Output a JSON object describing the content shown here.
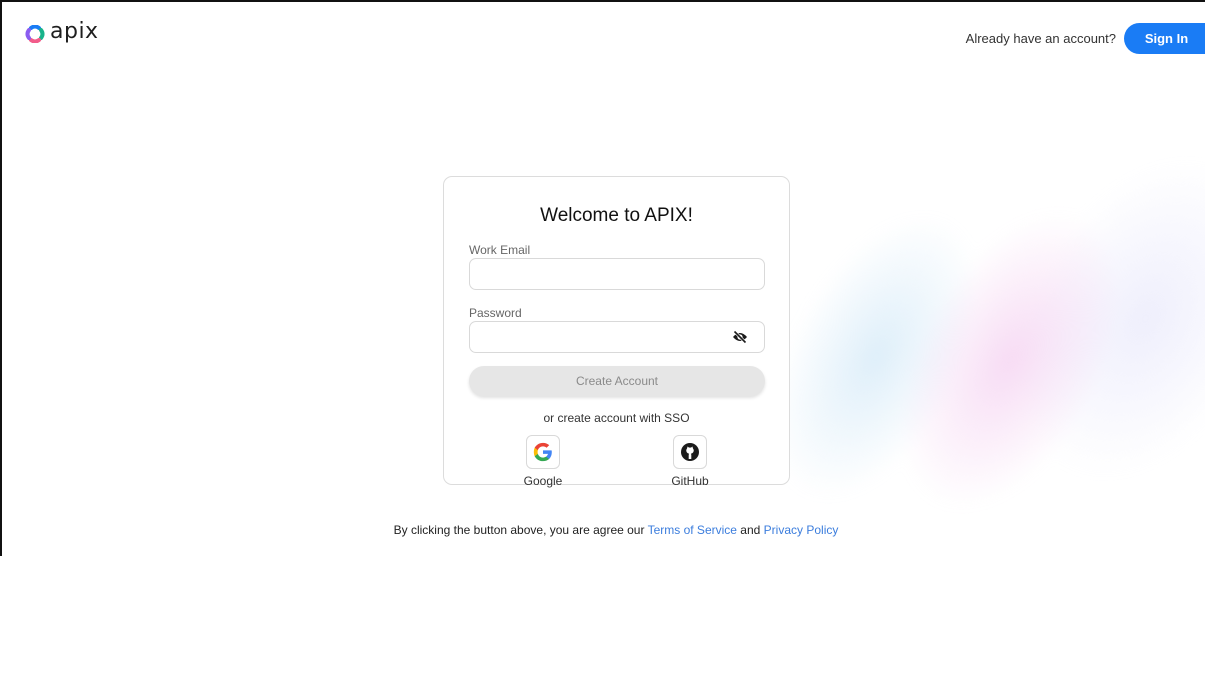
{
  "brand": {
    "name": "apix",
    "accent": "#1a7cf5"
  },
  "header": {
    "already_text": "Already have an account?",
    "signin_label": "Sign In"
  },
  "card": {
    "title": "Welcome to APIX!",
    "email": {
      "label": "Work Email",
      "value": "",
      "placeholder": ""
    },
    "password": {
      "label": "Password",
      "value": "",
      "placeholder": "",
      "toggle_icon": "eye-slash-icon"
    },
    "create_label": "Create Account",
    "sso_text": "or create account with SSO",
    "sso": [
      {
        "label": "Google",
        "icon": "google-icon"
      },
      {
        "label": "GitHub",
        "icon": "github-icon"
      }
    ]
  },
  "footer": {
    "prefix": "By clicking the button above, you are agree our",
    "terms": "Terms of Service",
    "and": "and",
    "privacy": "Privacy Policy"
  }
}
